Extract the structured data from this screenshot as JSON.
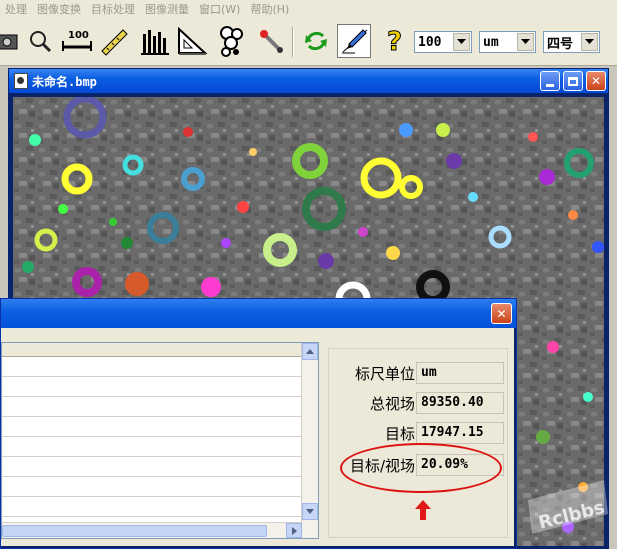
{
  "menubar": {
    "items": [
      "处理",
      "图像变换",
      "目标处理",
      "图像测量",
      "窗口(W)",
      "帮助(H)"
    ]
  },
  "toolbar": {
    "ruler_label": "100",
    "scale_value": "100",
    "unit_value": "um",
    "font_size_value": "四号"
  },
  "image_window": {
    "title": "未命名.bmp"
  },
  "stats": {
    "scale_unit_label": "标尺单位",
    "scale_unit_value": "um",
    "total_field_label": "总视场",
    "total_field_value": "89350.40",
    "target_label": "目标",
    "target_value": "17947.15",
    "ratio_label": "目标/视场",
    "ratio_value": "20.09%"
  },
  "watermark": {
    "text": "Rclbbs"
  },
  "colors": {
    "title_blue": "#0a5ee0",
    "close_red": "#c94419",
    "annotation_red": "#dd1111",
    "window_bg": "#ece9d8"
  }
}
